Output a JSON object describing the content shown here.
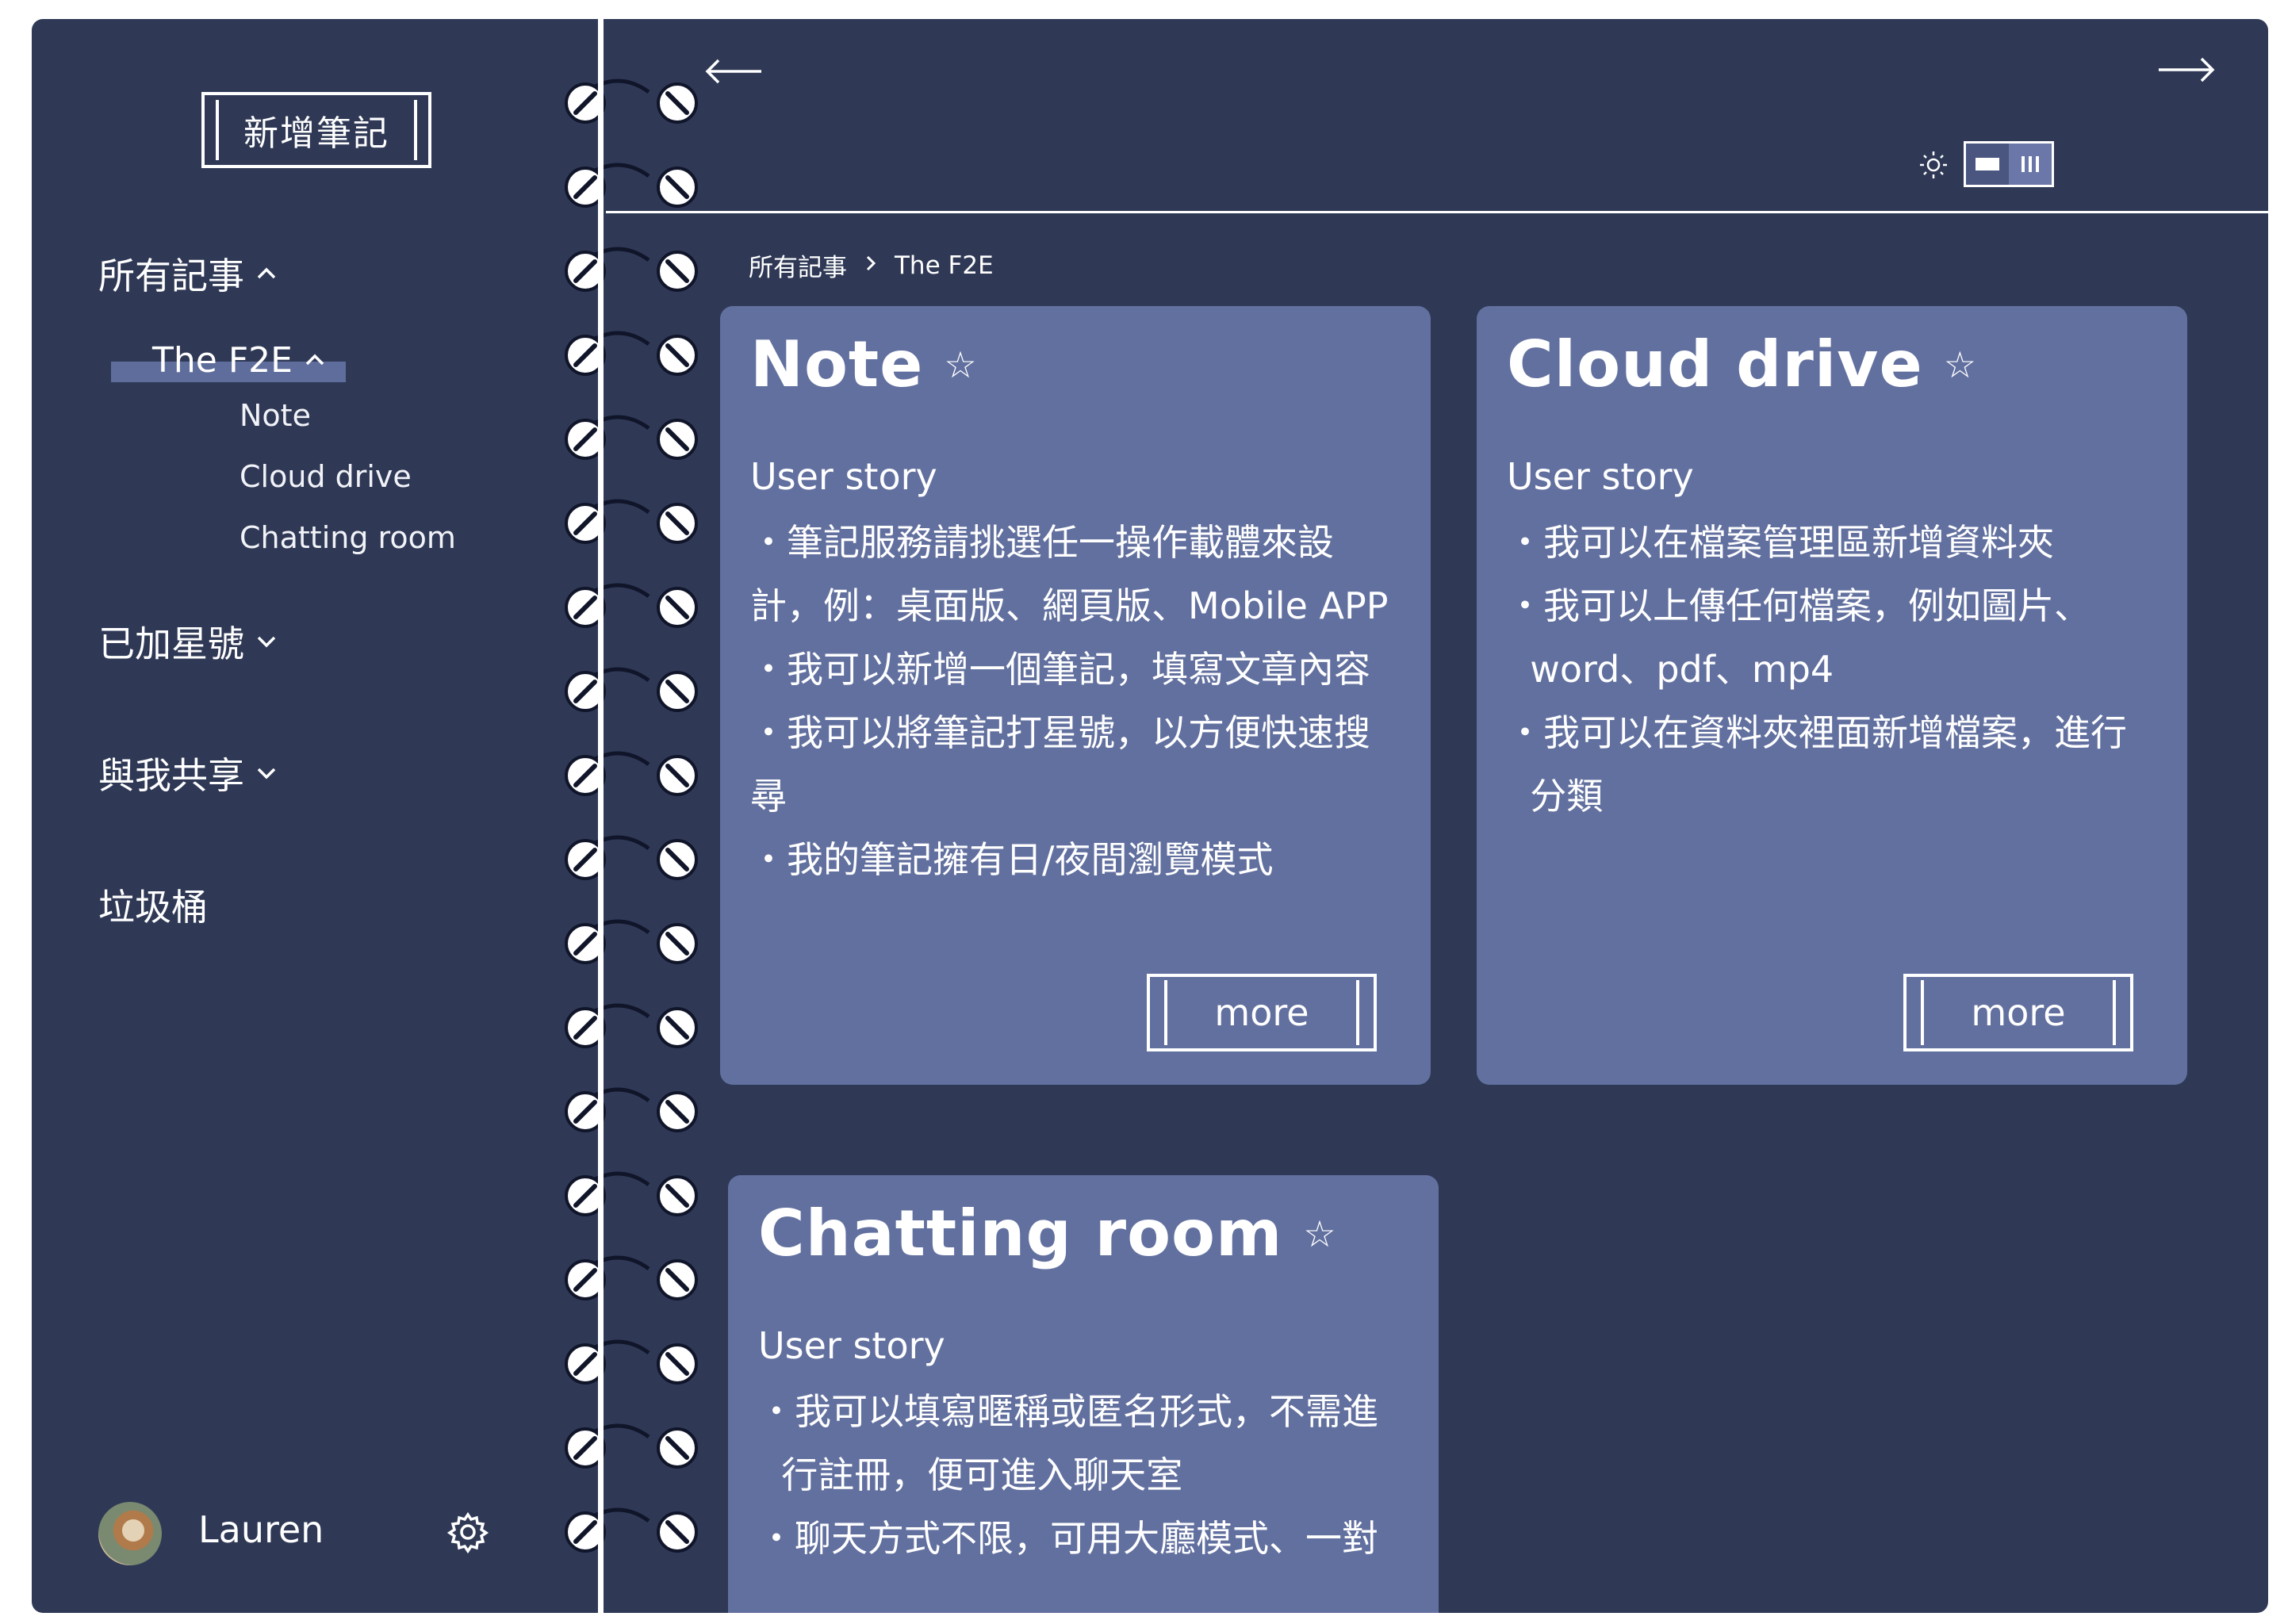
{
  "sidebar": {
    "new_note_label": "新增筆記",
    "all_notes": "所有記事",
    "notebook": "The F2E",
    "notebook_items": [
      "Note",
      "Cloud drive",
      "Chatting room"
    ],
    "starred": "已加星號",
    "shared": "與我共享",
    "trash": "垃圾桶",
    "user_name": "Lauren"
  },
  "breadcrumb": {
    "root": "所有記事",
    "current": "The F2E"
  },
  "cards": [
    {
      "title": "Note",
      "subtitle": "User story",
      "lines": [
        "・筆記服務請挑選任一操作載體來設",
        "計，例：桌面版、網頁版、Mobile APP",
        "・我可以新增一個筆記，填寫文章內容",
        "・我可以將筆記打星號，以方便快速搜",
        "尋",
        "・我的筆記擁有日/夜間瀏覽模式"
      ],
      "more_label": "more"
    },
    {
      "title": "Cloud drive",
      "subtitle": "User story",
      "lines": [
        "・我可以在檔案管理區新增資料夾",
        "・我可以上傳任何檔案，例如圖片、",
        "  word、pdf、mp4",
        "・我可以在資料夾裡面新增檔案，進行",
        "  分類"
      ],
      "more_label": "more"
    },
    {
      "title": "Chatting room",
      "subtitle": "User story",
      "lines": [
        "・我可以填寫暱稱或匿名形式，不需進",
        "  行註冊，便可進入聊天室",
        "・聊天方式不限，可用大廳模式、一對"
      ]
    }
  ],
  "colors": {
    "background": "#2f3956",
    "card": "#62709f",
    "highlight": "#5f6d9c",
    "text": "#ffffff"
  },
  "icons": [
    "arrow-left-icon",
    "arrow-right-icon",
    "sun-icon",
    "single-view-icon",
    "column-view-icon",
    "gear-icon",
    "star-icon",
    "chevron-up-icon",
    "chevron-down-icon"
  ]
}
